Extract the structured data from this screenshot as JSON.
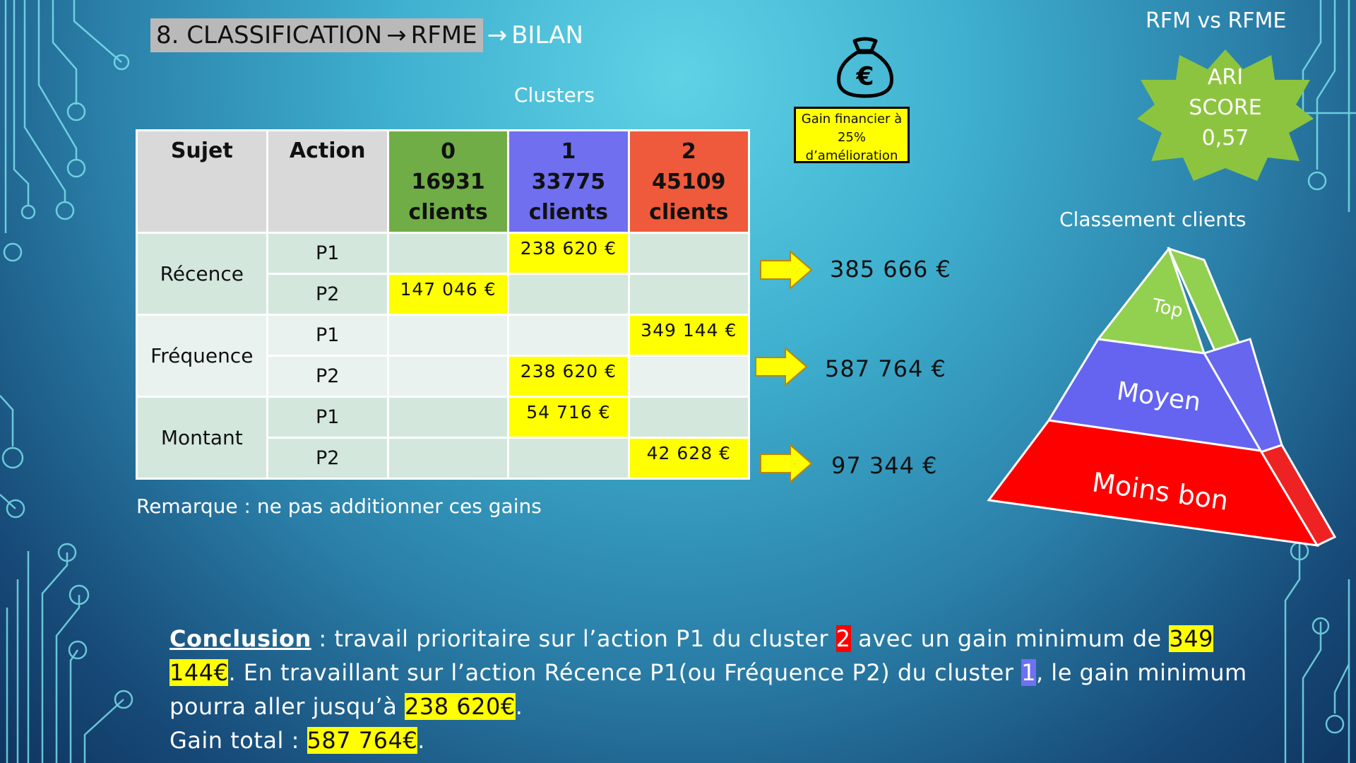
{
  "title": {
    "part1": "8. CLASSIFICATION",
    "arrow1": "→",
    "part2": "RFME",
    "arrow2": "→",
    "part3": "BILAN"
  },
  "clusters_label": "Clusters",
  "table": {
    "headers": {
      "subject": "Sujet",
      "action": "Action",
      "clusters": [
        {
          "id": "0",
          "count": "16931",
          "unit": "clients"
        },
        {
          "id": "1",
          "count": "33775",
          "unit": "clients"
        },
        {
          "id": "2",
          "count": "45109",
          "unit": "clients"
        }
      ]
    },
    "rows": [
      {
        "subject": "Récence",
        "action": "P1",
        "c0": "",
        "c1": "238 620 €",
        "c2": ""
      },
      {
        "subject": "",
        "action": "P2",
        "c0": "147 046 €",
        "c1": "",
        "c2": ""
      },
      {
        "subject": "Fréquence",
        "action": "P1",
        "c0": "",
        "c1": "",
        "c2": "349 144 €"
      },
      {
        "subject": "",
        "action": "P2",
        "c0": "",
        "c1": "238 620 €",
        "c2": ""
      },
      {
        "subject": "Montant",
        "action": "P1",
        "c0": "",
        "c1": "54 716 €",
        "c2": ""
      },
      {
        "subject": "",
        "action": "P2",
        "c0": "",
        "c1": "",
        "c2": "42 628 €"
      }
    ]
  },
  "sums": [
    "385 666 €",
    "587 764 €",
    "97 344 €"
  ],
  "remark": "Remarque : ne pas additionner ces gains",
  "gain_box": {
    "line1": "Gain financier à",
    "line2": "25%",
    "line3": "d’amélioration"
  },
  "moneybag_icon": "euro-moneybag-icon",
  "rfm": {
    "title": "RFM vs RFME",
    "line1": "ARI",
    "line2": "SCORE",
    "line3": "0,57"
  },
  "ranking": {
    "title": "Classement clients",
    "levels": [
      "Top",
      "Moyen",
      "Moins bon"
    ]
  },
  "conclusion": {
    "lead": "Conclusion",
    "t1": " : travail prioritaire sur l’action P1 du cluster ",
    "cluster_a": "2",
    "t2": " avec un gain minimum de ",
    "gain_a": "349 144€",
    "t3": ". En travaillant sur l’action Récence P1(ou Fréquence P2) du cluster ",
    "cluster_b": "1",
    "t4": ", le gain minimum pourra aller jusqu’à ",
    "gain_b": "238 620€",
    "t5": ".",
    "total_label": "Gain total : ",
    "total_value": "587 764€",
    "t6": "."
  },
  "colors": {
    "cluster0": "#70ad47",
    "cluster1": "#6f6ff0",
    "cluster2": "#ee5a3b",
    "highlight": "#ffff00",
    "star": "#8dc43f"
  }
}
